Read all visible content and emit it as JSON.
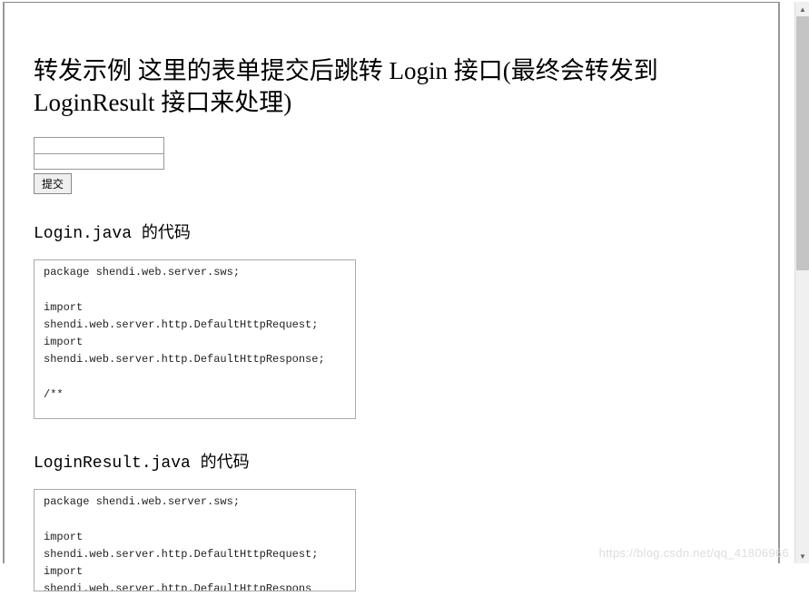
{
  "title": "转发示例 这里的表单提交后跳转 Login 接口(最终会转发到 LoginResult 接口来处理)",
  "form": {
    "input1_value": "",
    "input2_value": "",
    "submit_label": "提交"
  },
  "sections": [
    {
      "heading": "Login.java 的代码",
      "code": "package shendi.web.server.sws;\n\nimport\nshendi.web.server.http.DefaultHttpRequest;\nimport\nshendi.web.server.http.DefaultHttpResponse;\n\n/**"
    },
    {
      "heading": "LoginResult.java 的代码",
      "code": "package shendi.web.server.sws;\n\nimport\nshendi.web.server.http.DefaultHttpRequest;\nimport\nshendi.web.server.http.DefaultHttpRespons"
    }
  ],
  "watermark": "https://blog.csdn.net/qq_41806966"
}
